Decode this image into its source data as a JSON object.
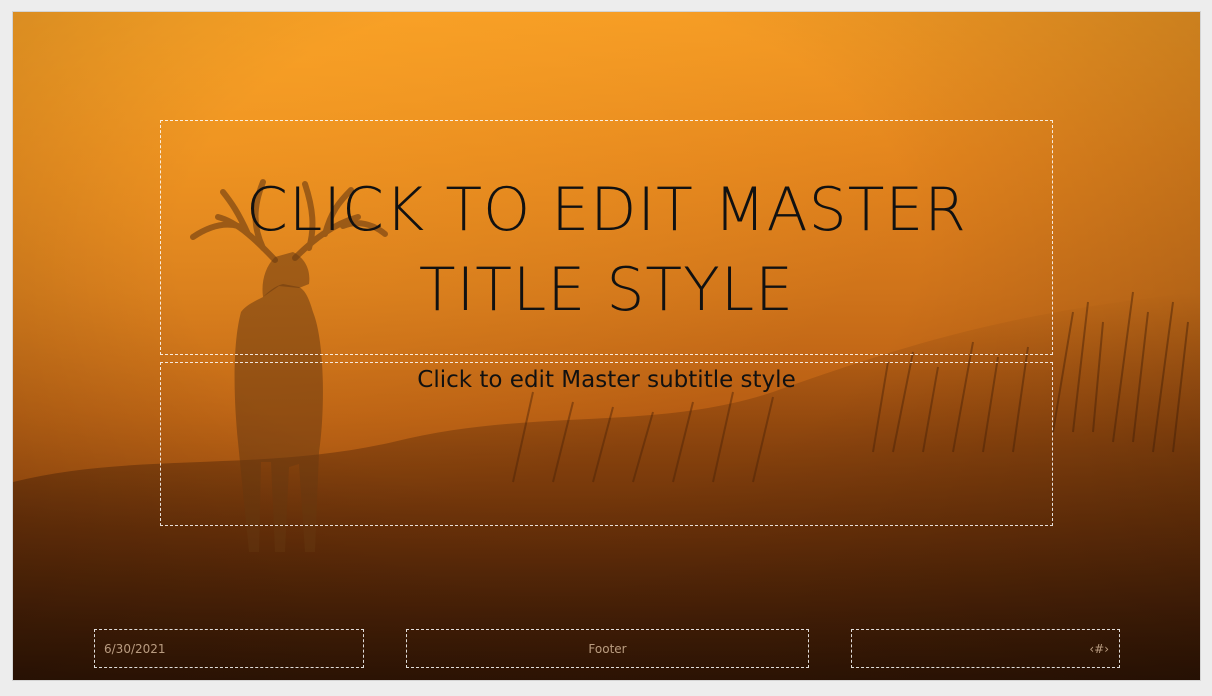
{
  "slide": {
    "title": "CLICK TO EDIT MASTER TITLE STYLE",
    "subtitle": "Click to edit Master subtitle style",
    "date": "6/30/2021",
    "footer": "Footer",
    "slide_number": "‹#›",
    "background_image": "deer-silhouette-at-sunset"
  },
  "colors": {
    "sky_top": "#f49a24",
    "ground_bottom": "#5a2a08",
    "text": "#111111"
  }
}
